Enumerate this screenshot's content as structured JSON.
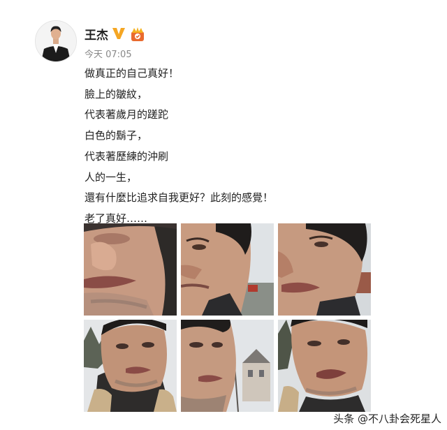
{
  "header": {
    "name": "王杰",
    "time": "今天 07:05",
    "icons": [
      "verified-v-icon",
      "crown-badge-icon"
    ],
    "colors": {
      "verified": "#f5a623",
      "crown": "#e96a2e"
    }
  },
  "post": {
    "lines": [
      "做真正的自己真好！",
      "臉上的皺紋，",
      "代表著歲月的蹉跎",
      "白色的鬍子，",
      "代表著歷練的沖刷",
      "人的一生，",
      "還有什麼比追求自我更好？此刻的感覺！",
      "老了真好……"
    ]
  },
  "photos": [
    "selfie-closeup-nose-mouth",
    "selfie-profile-right-street",
    "selfie-closeup-face-grey-sky",
    "selfie-fur-collar-bare-trees",
    "selfie-face-tilted-church",
    "selfie-closeup-mouth-talking"
  ],
  "watermark": "头条 @不八卦会死星人"
}
